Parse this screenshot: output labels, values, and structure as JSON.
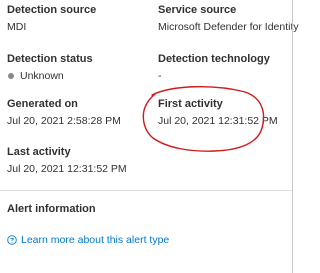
{
  "details": {
    "detection_source": {
      "label": "Detection source",
      "value": "MDI"
    },
    "service_source": {
      "label": "Service source",
      "value": "Microsoft Defender for Identity"
    },
    "detection_status": {
      "label": "Detection status",
      "value": "Unknown"
    },
    "detection_technology": {
      "label": "Detection technology",
      "value": "-"
    },
    "generated_on": {
      "label": "Generated on",
      "value": "Jul 20, 2021 2:58:28 PM"
    },
    "first_activity": {
      "label": "First activity",
      "value": "Jul 20, 2021 12:31:52 PM"
    },
    "last_activity": {
      "label": "Last activity",
      "value": "Jul 20, 2021 12:31:52 PM"
    }
  },
  "alert_information": {
    "title": "Alert information",
    "learn_more_link": "Learn more about this alert type",
    "icon": "help-circle-icon"
  },
  "colors": {
    "link": "#0078d4",
    "status_dot": "#8a8886",
    "annotation": "#d11a1a"
  }
}
